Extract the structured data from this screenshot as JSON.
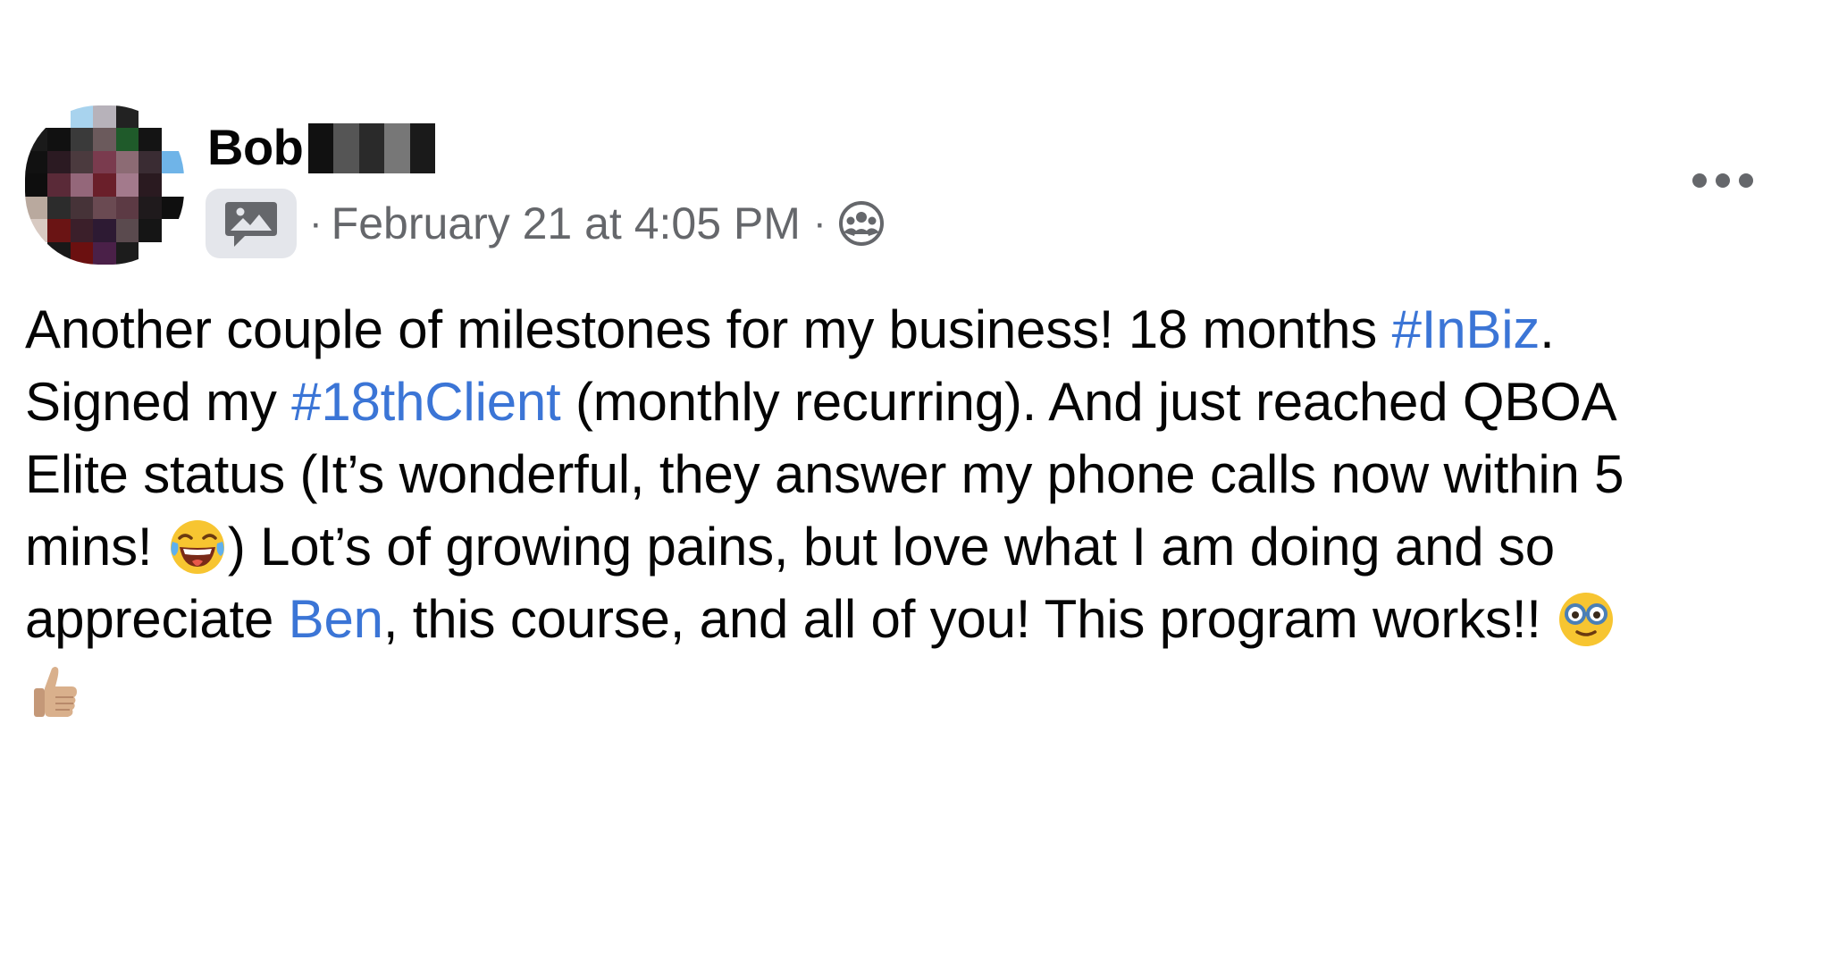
{
  "post": {
    "author": {
      "name_visible": "Bob",
      "avatar_icon": "avatar-pixelated"
    },
    "meta": {
      "group_icon": "group-chat-photo-icon",
      "separator": "·",
      "timestamp": "February 21 at 4:05 PM",
      "audience_icon": "group-members-icon"
    },
    "more_icon": "more-dots-icon",
    "text": {
      "l1_a": "Another couple of milestones for my business! 18 months ",
      "l1_tag": "#InBiz",
      "l1_b": ".",
      "l2_a": "Signed my ",
      "l2_tag": "#18thClient",
      "l2_b": " (monthly recurring). And just reached QBOA",
      "l3": "Elite status (It’s wonderful, they answer my phone calls now within 5",
      "l4_a": "mins! ",
      "l4_emoji": "tears-of-joy-emoji",
      "l4_b": ") Lot’s of growing pains, but love what I am doing and so",
      "l5_a": "appreciate ",
      "l5_mention": "Ben",
      "l5_b": ", this course, and all of you! This program works!! ",
      "l5_emoji": "nerd-glasses-emoji",
      "l6_emoji": "thumbs-up-emoji"
    }
  },
  "colors": {
    "text": "#050505",
    "secondary": "#65676b",
    "link": "#3b75d6",
    "badge_bg": "#e4e6eb"
  }
}
